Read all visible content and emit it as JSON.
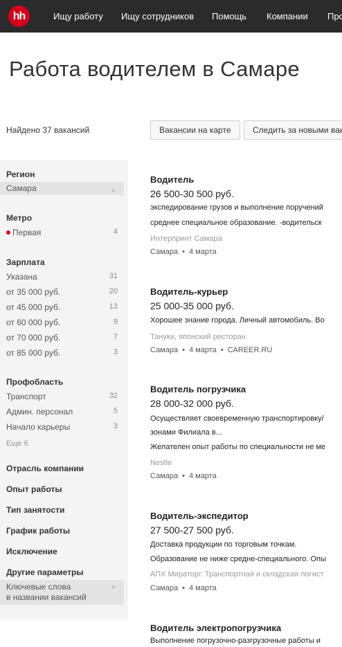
{
  "nav": {
    "logo": "hh",
    "items": [
      "Ищу работу",
      "Ищу сотрудников",
      "Помощь",
      "Компании",
      "Про"
    ]
  },
  "page": {
    "title": "Работа водителем в Самаре",
    "found": "Найдено 37 вакансий",
    "map_button": "Вакансии на карте",
    "follow_button": "Следить за новыми вак"
  },
  "sidebar": {
    "region": {
      "title": "Регион",
      "selected": "Самара",
      "remove": "×"
    },
    "metro": {
      "title": "Метро",
      "item": {
        "label": "Первая",
        "count": "4"
      }
    },
    "salary": {
      "title": "Зарплата",
      "items": [
        {
          "label": "Указана",
          "count": "31"
        },
        {
          "label": "от 35 000 руб.",
          "count": "20"
        },
        {
          "label": "от 45 000 руб.",
          "count": "13"
        },
        {
          "label": "от 60 000 руб.",
          "count": "9"
        },
        {
          "label": "от 70 000 руб.",
          "count": "7"
        },
        {
          "label": "от 85 000 руб.",
          "count": "3"
        }
      ]
    },
    "prof": {
      "title": "Профобласть",
      "items": [
        {
          "label": "Транспорт",
          "count": "32"
        },
        {
          "label": "Админ. персонал",
          "count": "5"
        },
        {
          "label": "Начало карьеры",
          "count": "3"
        }
      ],
      "more": "Еще 6"
    },
    "sections": [
      "Отрасль компании",
      "Опыт работы",
      "Тип занятости",
      "График работы",
      "Исключение",
      "Другие параметры"
    ],
    "keywords": {
      "line1": "Ключевые слова",
      "line2": "в названии вакансий",
      "remove": "×"
    }
  },
  "vacancies": [
    {
      "title": "Водитель",
      "salary": "26 500-30 500 руб.",
      "desc": [
        "экспедирование грузов и выполнение поручений",
        "среднее специальное образование. -водительск"
      ],
      "company": "Интерпринт Самара",
      "city": "Самара",
      "date": "4 марта",
      "source": ""
    },
    {
      "title": "Водитель-курьер",
      "salary": "25 000-35 000 руб.",
      "desc": [
        "Хорошее знание города. Личный автомобиль. Во"
      ],
      "company": "Тануки, японский ресторан",
      "city": "Самара",
      "date": "4 марта",
      "source": "CAREER.RU"
    },
    {
      "title": "Водитель погрузчика",
      "salary": "28 000-32 000 руб.",
      "desc": [
        "Осуществляет своевременную транспортировку/",
        "зонами Филиала в...",
        "Желателен опыт работы по специальности не ме"
      ],
      "company": "Nestle",
      "city": "Самара",
      "date": "4 марта",
      "source": ""
    },
    {
      "title": "Водитель-экспедитор",
      "salary": "27 500-27 500 руб.",
      "desc": [
        "Доставка продукции по торговым точкам.",
        "Образование не ниже средне-специального. Опы"
      ],
      "company": "АПХ Мираторг. Транспортная и складская логист",
      "city": "Самара",
      "date": "4 марта",
      "source": ""
    },
    {
      "title": "Водитель электропогрузчика",
      "desc": [
        "Выполнение погрузочно-разгрузочные работы и"
      ]
    }
  ]
}
